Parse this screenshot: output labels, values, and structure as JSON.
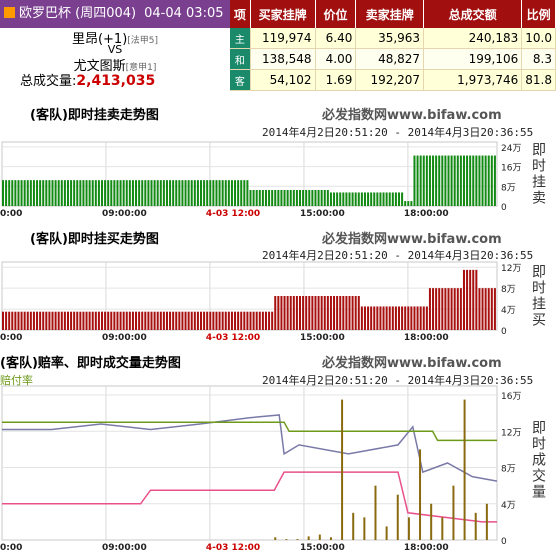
{
  "header": {
    "league": "欧罗巴杯",
    "match_no": "(周四004)",
    "match_time": "04-04 03:05",
    "home_team": "里昂(+1)",
    "home_rank": "[法甲5]",
    "vs": "VS",
    "away_team": "尤文图斯",
    "away_rank": "[意甲1]",
    "total_volume_label": "总成交量:",
    "total_volume": "2,413,035"
  },
  "table": {
    "headers": [
      "项",
      "买家挂牌",
      "价位",
      "卖家挂牌",
      "总成交额",
      "比例"
    ],
    "rows": [
      {
        "label": "主",
        "buy": "119,974",
        "price": "6.40",
        "sell": "35,963",
        "total": "240,183",
        "ratio": "10.0"
      },
      {
        "label": "和",
        "buy": "138,548",
        "price": "4.00",
        "sell": "48,827",
        "total": "199,106",
        "ratio": "8.3"
      },
      {
        "label": "客",
        "buy": "54,102",
        "price": "1.69",
        "sell": "192,207",
        "total": "1,973,746",
        "ratio": "81.8"
      }
    ]
  },
  "watermark": "必发指数网www.bifaw.com",
  "date_range": "2014年4月2日20:51:20 - 2014年4月3日20:36:55",
  "colors": {
    "header_purple": "#7a3f8f",
    "table_header": "#a10f0f",
    "row_label": "#1a8a6a",
    "sell_bar": "#138a13",
    "buy_bar": "#a80f0f",
    "odds_line": "#e8508a",
    "volume_line": "#7a7aa8",
    "ratio_line": "#6e9a1a",
    "volume_bar": "#8a6a10"
  },
  "chart_data": [
    {
      "type": "bar",
      "title": "(客队)即时挂卖走势图",
      "ylabel": "即时挂卖",
      "x_ticks": [
        "0:00",
        "09:00:00",
        "4-03 12:00",
        "15:00:00",
        "18:00:00"
      ],
      "y_ticks": [
        "0",
        "8万",
        "16万",
        "24万"
      ],
      "ylim": [
        0,
        26
      ],
      "unit": "万",
      "segments": [
        {
          "from": 0.0,
          "to": 0.5,
          "value": 10.5
        },
        {
          "from": 0.5,
          "to": 0.66,
          "value": 6.5
        },
        {
          "from": 0.66,
          "to": 0.81,
          "value": 5.5
        },
        {
          "from": 0.81,
          "to": 0.83,
          "value": 2.0
        },
        {
          "from": 0.83,
          "to": 1.0,
          "value": 20.5
        }
      ]
    },
    {
      "type": "bar",
      "title": "(客队)即时挂买走势图",
      "ylabel": "即时挂买",
      "x_ticks": [
        "0:00",
        "09:00:00",
        "4-03 12:00",
        "15:00:00",
        "18:00:00"
      ],
      "y_ticks": [
        "0",
        "4万",
        "8万",
        "12万"
      ],
      "ylim": [
        0,
        13
      ],
      "unit": "万",
      "segments": [
        {
          "from": 0.0,
          "to": 0.55,
          "value": 3.5
        },
        {
          "from": 0.55,
          "to": 0.72,
          "value": 6.5
        },
        {
          "from": 0.72,
          "to": 0.86,
          "value": 4.5
        },
        {
          "from": 0.86,
          "to": 0.93,
          "value": 8.0
        },
        {
          "from": 0.93,
          "to": 0.96,
          "value": 11.5
        },
        {
          "from": 0.96,
          "to": 1.0,
          "value": 8.0
        }
      ]
    },
    {
      "type": "line",
      "title": "(客队)赔率、即时成交量走势图",
      "ylabel": "即时成交量",
      "legend": [
        "赔付率"
      ],
      "x_ticks": [
        "0:00",
        "09:00:00",
        "4-03 12:00",
        "15:00:00",
        "18:00:00"
      ],
      "y_ticks": [
        "0",
        "4万",
        "8万",
        "12万",
        "16万"
      ],
      "ylim": [
        0,
        17
      ],
      "unit": "万",
      "series": [
        {
          "name": "即时成交量",
          "color": "#7a7aa8",
          "x": [
            0.0,
            0.1,
            0.2,
            0.3,
            0.4,
            0.5,
            0.56,
            0.57,
            0.6,
            0.7,
            0.8,
            0.83,
            0.85,
            0.9,
            0.95,
            1.0
          ],
          "y": [
            12.2,
            12.2,
            12.8,
            12.2,
            12.8,
            13.5,
            13.8,
            9.5,
            10.5,
            9.5,
            10.5,
            12.5,
            7.5,
            8.5,
            7.0,
            6.5
          ]
        },
        {
          "name": "赔付率",
          "color": "#6e9a1a",
          "x": [
            0.0,
            0.3,
            0.57,
            0.58,
            0.87,
            0.88,
            1.0
          ],
          "y": [
            13.0,
            13.0,
            13.0,
            12.0,
            12.0,
            11.0,
            11.0
          ]
        },
        {
          "name": "赔率",
          "color": "#e8508a",
          "x": [
            0.0,
            0.28,
            0.3,
            0.55,
            0.57,
            0.8,
            0.82,
            0.97,
            1.0
          ],
          "y": [
            4.0,
            4.0,
            5.5,
            5.5,
            7.5,
            7.5,
            3.0,
            2.0,
            2.0
          ]
        }
      ],
      "volume_bars": [
        0.3,
        0.1,
        0.1,
        0.4,
        0.6,
        0.3,
        15.5,
        3.0,
        2.5,
        6.0,
        1.5,
        5.0,
        2.5,
        10.0,
        4.0,
        2.5,
        6.0,
        15.5,
        3.0,
        4.0
      ]
    }
  ]
}
